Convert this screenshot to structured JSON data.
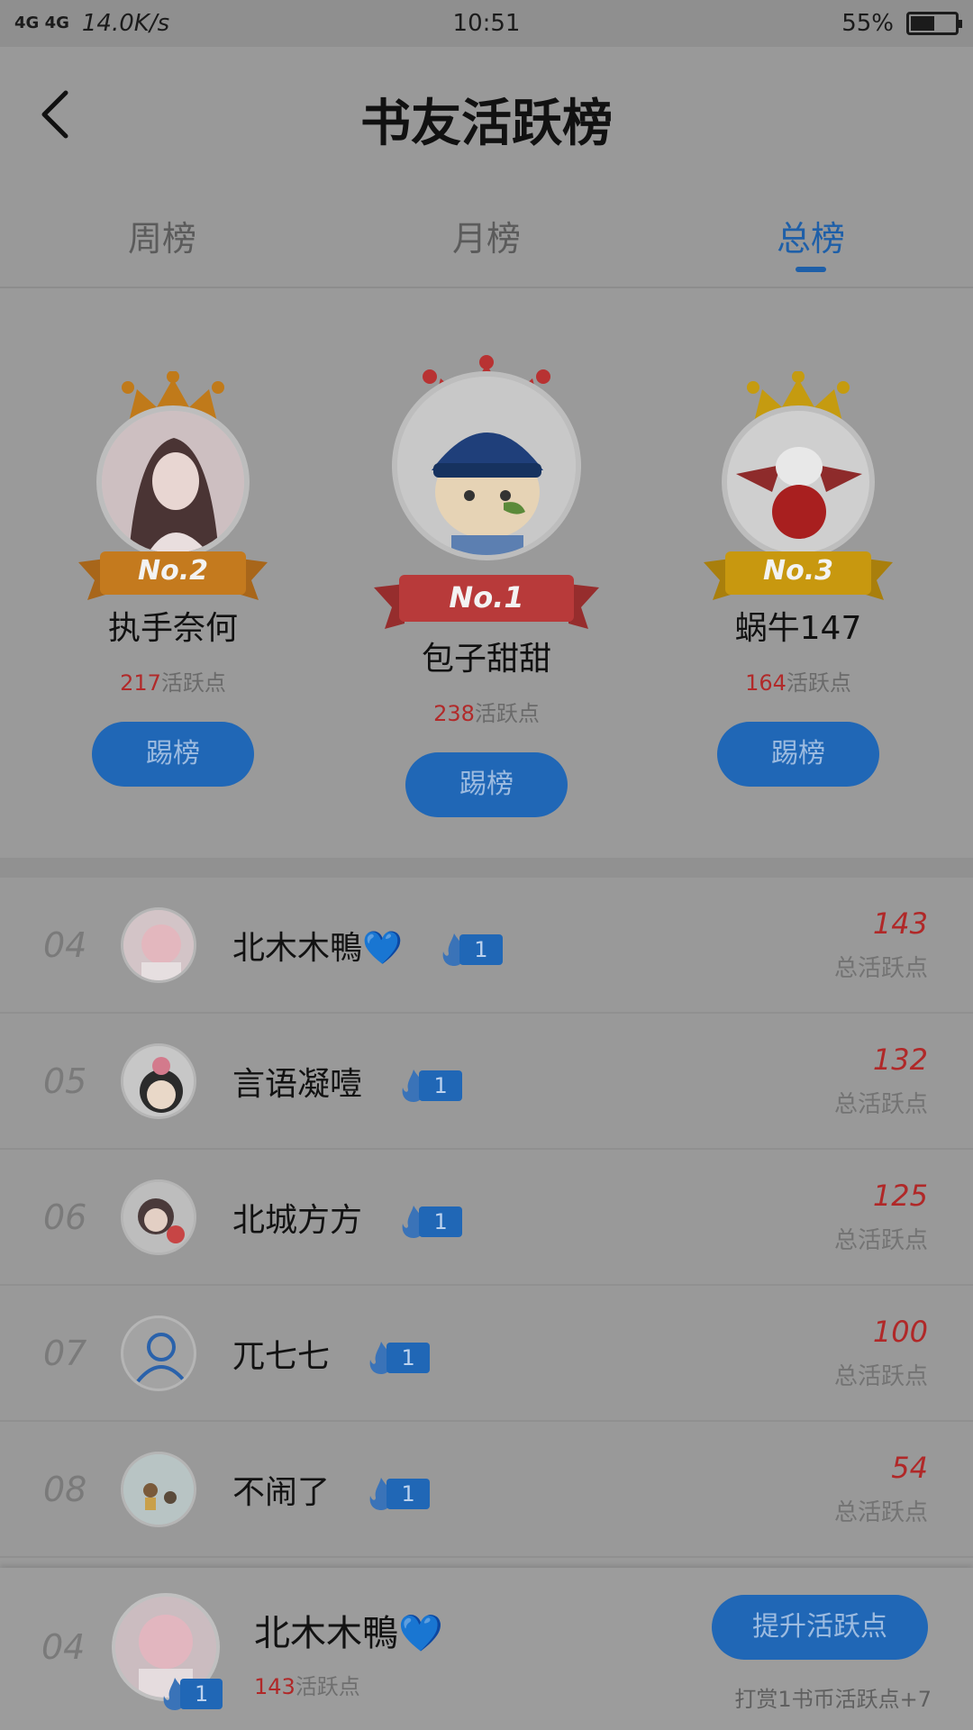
{
  "status_bar": {
    "signal": "4G 4G",
    "speed": "14.0K/s",
    "time": "10:51",
    "battery": "55%",
    "battery_level": 0.55
  },
  "header": {
    "title": "书友活跃榜"
  },
  "tabs": [
    {
      "label": "周榜",
      "active": false
    },
    {
      "label": "月榜",
      "active": false
    },
    {
      "label": "总榜",
      "active": true
    }
  ],
  "podium": {
    "first": {
      "badge": "No.1",
      "name": "包子甜甜",
      "points": "238",
      "points_label": "活跃点",
      "button": "踢榜",
      "crown_color": "#b83232",
      "ribbon_color": "#b83a3a"
    },
    "second": {
      "badge": "No.2",
      "name": "执手奈何",
      "points": "217",
      "points_label": "活跃点",
      "button": "踢榜",
      "crown_color": "#c07a1a",
      "ribbon_color": "#c47a1e"
    },
    "third": {
      "badge": "No.3",
      "name": "蜗牛147",
      "points": "164",
      "points_label": "活跃点",
      "button": "踢榜",
      "crown_color": "#c59b10",
      "ribbon_color": "#c8980f"
    }
  },
  "list": [
    {
      "rank": "04",
      "name": "北木木鴨💙",
      "badge": "1",
      "score": "143",
      "score_label": "总活跃点",
      "avatar": "anime-girl-pink"
    },
    {
      "rank": "05",
      "name": "言语凝噎",
      "badge": "1",
      "score": "132",
      "score_label": "总活跃点",
      "avatar": "doll-girl"
    },
    {
      "rank": "06",
      "name": "北城方方",
      "badge": "1",
      "score": "125",
      "score_label": "总活跃点",
      "avatar": "photo-girl"
    },
    {
      "rank": "07",
      "name": "兀七七",
      "badge": "1",
      "score": "100",
      "score_label": "总活跃点",
      "avatar": "default-user-icon"
    },
    {
      "rank": "08",
      "name": "不闹了",
      "badge": "1",
      "score": "54",
      "score_label": "总活跃点",
      "avatar": "cartoon-kids"
    }
  ],
  "my_rank": {
    "rank": "04",
    "name": "北木木鴨💙",
    "badge": "1",
    "points": "143",
    "points_label": "活跃点",
    "button": "提升活跃点",
    "tip": "打赏1书币活跃点+7"
  },
  "colors": {
    "accent": "#2067b6",
    "score_red": "#b02828",
    "overlay_bg": "#999999"
  }
}
